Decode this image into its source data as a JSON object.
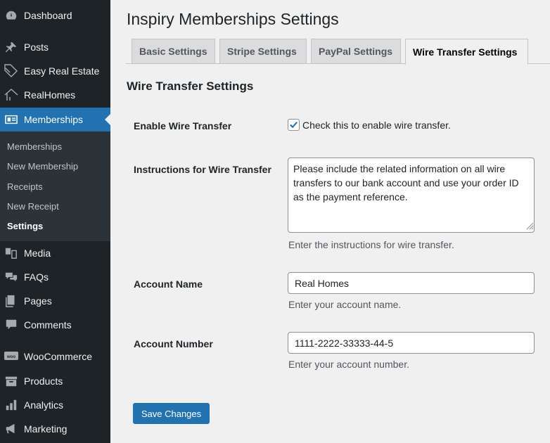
{
  "sidebar": {
    "items": [
      {
        "label": "Dashboard",
        "icon": "dashboard-icon"
      },
      {
        "label": "Posts",
        "icon": "pin-icon"
      },
      {
        "label": "Easy Real Estate",
        "icon": "tag-icon"
      },
      {
        "label": "RealHomes",
        "icon": "house-icon"
      },
      {
        "label": "Memberships",
        "icon": "id-card-icon"
      },
      {
        "label": "Media",
        "icon": "media-icon"
      },
      {
        "label": "FAQs",
        "icon": "chat-bubbles-icon"
      },
      {
        "label": "Pages",
        "icon": "pages-icon"
      },
      {
        "label": "Comments",
        "icon": "comment-icon"
      },
      {
        "label": "WooCommerce",
        "icon": "woo-icon"
      },
      {
        "label": "Products",
        "icon": "archive-box-icon"
      },
      {
        "label": "Analytics",
        "icon": "bar-chart-icon"
      },
      {
        "label": "Marketing",
        "icon": "megaphone-icon"
      }
    ],
    "submenu": [
      "Memberships",
      "New Membership",
      "Receipts",
      "New Receipt",
      "Settings"
    ]
  },
  "page": {
    "title": "Inspiry Memberships Settings",
    "tabs": [
      "Basic Settings",
      "Stripe Settings",
      "PayPal Settings",
      "Wire Transfer Settings"
    ],
    "active_tab": "Wire Transfer Settings",
    "section_title": "Wire Transfer Settings"
  },
  "form": {
    "enable_label": "Enable Wire Transfer",
    "enable_checkbox_label": "Check this to enable wire transfer.",
    "enable_checked": true,
    "instructions_label": "Instructions for Wire Transfer",
    "instructions_value": "Please include the related information on all wire transfers to our bank account and use your order ID as the payment reference.",
    "instructions_desc": "Enter the instructions for wire transfer.",
    "account_name_label": "Account Name",
    "account_name_value": "Real Homes",
    "account_name_desc": "Enter your account name.",
    "account_number_label": "Account Number",
    "account_number_value": "1111-2222-33333-44-5",
    "account_number_desc": "Enter your account number.",
    "save_label": "Save Changes"
  },
  "colors": {
    "sidebar_bg": "#1d2327",
    "accent": "#2271b1",
    "page_bg": "#f0f0f1"
  }
}
